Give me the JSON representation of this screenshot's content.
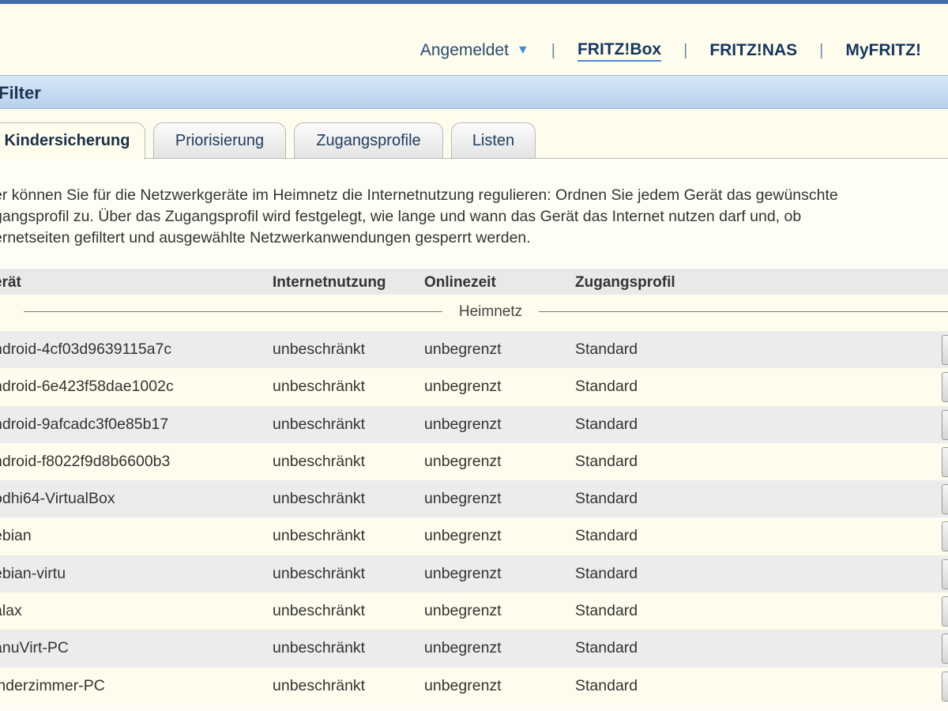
{
  "nav": {
    "user": "Angemeldet",
    "links": [
      "FRITZ!Box",
      "FRITZ!NAS",
      "MyFRITZ!"
    ],
    "separator": "|"
  },
  "page": {
    "title": "Filter"
  },
  "tabs": [
    "Kindersicherung",
    "Priorisierung",
    "Zugangsprofile",
    "Listen"
  ],
  "description": [
    "er können Sie für die Netzwerkgeräte im Heimnetz die Internetnutzung regulieren: Ordnen Sie jedem Gerät das gewünschte",
    "gangsprofil zu. Über das Zugangsprofil wird festgelegt, wie lange und wann das Gerät das Internet nutzen darf und, ob",
    "ernetseiten gefiltert und ausgewählte Netzwerkanwendungen gesperrt werden."
  ],
  "table": {
    "headers": [
      "erät",
      "Internetnutzung",
      "Onlinezeit",
      "Zugangsprofil"
    ],
    "group": "Heimnetz",
    "rows": [
      [
        "ndroid-4cf03d9639115a7c",
        "unbeschränkt",
        "unbegrenzt",
        "Standard"
      ],
      [
        "ndroid-6e423f58dae1002c",
        "unbeschränkt",
        "unbegrenzt",
        "Standard"
      ],
      [
        "ndroid-9afcadc3f0e85b17",
        "unbeschränkt",
        "unbegrenzt",
        "Standard"
      ],
      [
        "ndroid-f8022f9d8b6600b3",
        "unbeschränkt",
        "unbegrenzt",
        "Standard"
      ],
      [
        "odhi64-VirtualBox",
        "unbeschränkt",
        "unbegrenzt",
        "Standard"
      ],
      [
        "ebian",
        "unbeschränkt",
        "unbegrenzt",
        "Standard"
      ],
      [
        "ebian-virtu",
        "unbeschränkt",
        "unbegrenzt",
        "Standard"
      ],
      [
        "alax",
        "unbeschränkt",
        "unbegrenzt",
        "Standard"
      ],
      [
        "anuVirt-PC",
        "unbeschränkt",
        "unbegrenzt",
        "Standard"
      ],
      [
        "inderzimmer-PC",
        "unbeschränkt",
        "unbegrenzt",
        "Standard"
      ]
    ]
  },
  "icons": {
    "user_menu": "triangle-down-icon",
    "row_action": "edit-button-icon"
  },
  "colors": {
    "accent": "#3d6fa8",
    "header_bg": "#fefded",
    "title_bar": "#c8dcf1",
    "link": "#17365e"
  }
}
